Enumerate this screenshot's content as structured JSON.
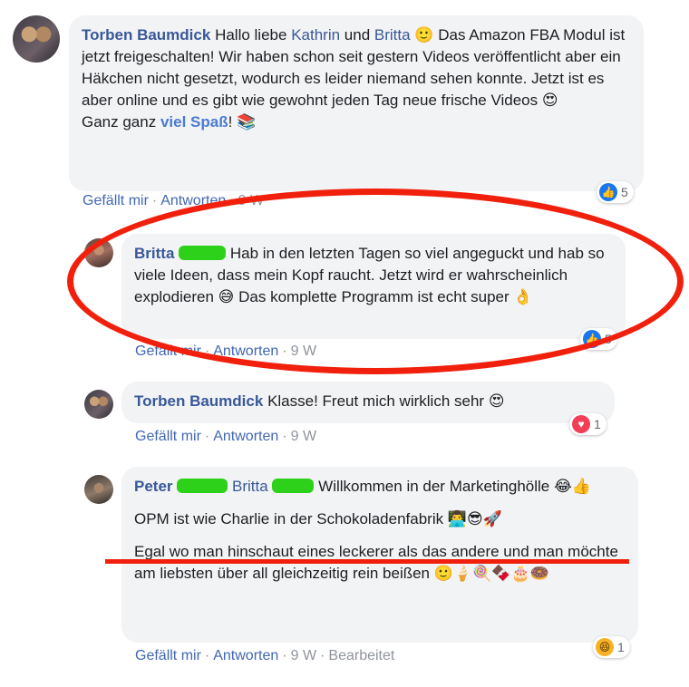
{
  "comments": [
    {
      "author": "Torben Baumdick",
      "text_1": "Hallo liebe",
      "mention_1": "Kathrin",
      "text_2": "und",
      "mention_2": "Britta",
      "text_3": "Das Amazon FBA Modul ist jetzt freigeschalten! Wir haben schon seit gestern Videos veröffentlicht aber ein Häkchen nicht gesetzt, wodurch es leider niemand sehen konnte. Jetzt ist es aber online und es gibt wie gewohnt jeden Tag neue frische Videos",
      "line2_prefix": "Ganz ganz",
      "line2_link": "viel Spaß",
      "line2_suffix": "!",
      "like": "Gefällt mir",
      "reply": "Antworten",
      "time": "9 W",
      "reaction_count": "5"
    },
    {
      "author": "Britta",
      "text": "Hab in den letzten Tagen so viel angeguckt und hab so viele Ideen, dass mein Kopf raucht. Jetzt wird er wahrscheinlich explodieren",
      "text_end": "Das komplette Programm ist echt super",
      "like": "Gefällt mir",
      "reply": "Antworten",
      "time": "9 W",
      "reaction_count": "5"
    },
    {
      "author": "Torben Baumdick",
      "text": "Klasse! Freut mich wirklich sehr",
      "like": "Gefällt mir",
      "reply": "Antworten",
      "time": "9 W",
      "reaction_count": "1"
    },
    {
      "author": "Peter",
      "mention": "Britta",
      "text_1": "Willkommen in der Marketinghölle",
      "text_2": "OPM ist wie Charlie in der Schokoladenfabrik",
      "text_3": "Egal wo man hinschaut eines leckerer als das andere und man möchte am liebsten über all gleichzeitig rein beißen",
      "like": "Gefällt mir",
      "reply": "Antworten",
      "time": "9 W",
      "edited": "Bearbeitet",
      "reaction_count": "1"
    }
  ],
  "emojis": {
    "smile": "🙂",
    "heart_eyes": "😍",
    "books": "📚",
    "sweat_smile": "😅",
    "ok_hand": "👌",
    "joy": "😂",
    "thumbs_up": "👍",
    "technologist": "👨‍💻",
    "sunglasses": "😎",
    "rocket": "🚀",
    "ice_cream": "🍦",
    "lollipop": "🍭",
    "chocolate": "🍫",
    "cake": "🎂",
    "doughnut": "🍩",
    "like_icon": "👍",
    "love_icon": "♥",
    "haha_icon": "😆"
  },
  "colors": {
    "link": "#385898",
    "annotation_red": "#f0200d",
    "redaction_green": "#2ed11a",
    "bubble": "#f2f3f5"
  }
}
